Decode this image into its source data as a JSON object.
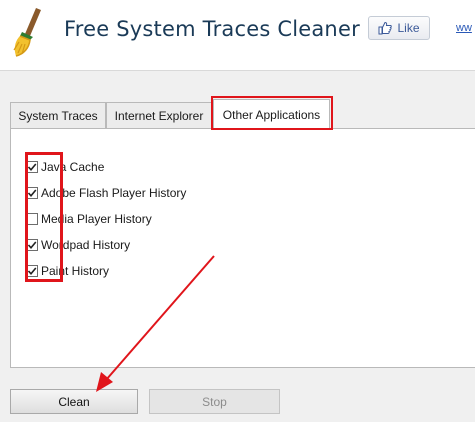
{
  "app": {
    "title": "Free System Traces Cleaner",
    "like_label": "Like",
    "more_link": "ww"
  },
  "tabs": [
    {
      "label": "System Traces",
      "active": false
    },
    {
      "label": "Internet Explorer",
      "active": false
    },
    {
      "label": "Other Applications",
      "active": true
    }
  ],
  "options": [
    {
      "label": "Java Cache",
      "checked": true
    },
    {
      "label": "Adobe Flash Player History",
      "checked": true
    },
    {
      "label": "Media Player History",
      "checked": false
    },
    {
      "label": "Wordpad History",
      "checked": true
    },
    {
      "label": "Paint History",
      "checked": true
    }
  ],
  "buttons": {
    "clean": "Clean",
    "stop": "Stop"
  },
  "colors": {
    "highlight": "#e0151b",
    "title": "#1a3a57",
    "facebook": "#3b5998"
  }
}
